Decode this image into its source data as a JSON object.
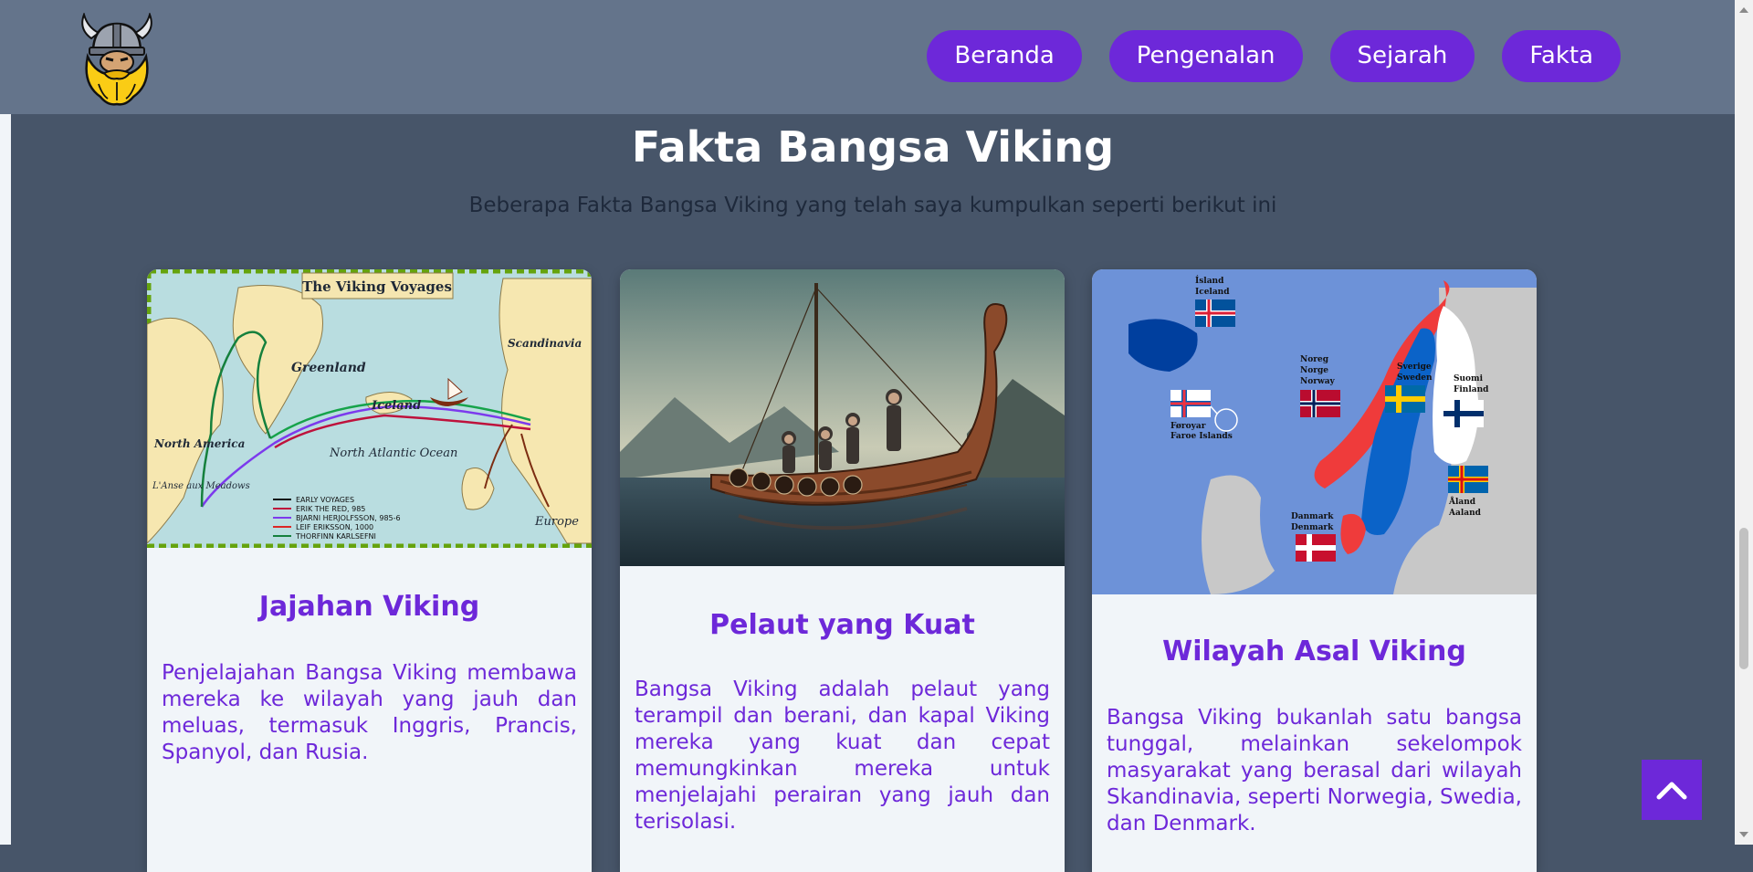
{
  "nav": {
    "items": [
      {
        "label": "Beranda"
      },
      {
        "label": "Pengenalan"
      },
      {
        "label": "Sejarah"
      },
      {
        "label": "Fakta"
      }
    ]
  },
  "section": {
    "title": "Fakta Bangsa Viking",
    "subtitle": "Beberapa Fakta Bangsa Viking yang telah saya kumpulkan seperti berikut ini"
  },
  "cards": [
    {
      "title": "Jajahan Viking",
      "text": "Penjelajahan Bangsa Viking membawa mereka ke wilayah yang jauh dan meluas, termasuk Inggris, Prancis, Spanyol, dan Rusia.",
      "image": {
        "map_title": "The Viking Voyages",
        "labels": [
          "Greenland",
          "Iceland",
          "Scandinavia",
          "North America",
          "North Atlantic Ocean",
          "L'Anse aux Meadows",
          "Europe"
        ],
        "legend": [
          "EARLY VOYAGES",
          "ERIK THE RED, 985",
          "BJARNI HERJOLFSSON, 985-6",
          "LEIF ERIKSSON, 1000",
          "THORFINN KARLSEFNI"
        ]
      }
    },
    {
      "title": "Pelaut yang Kuat",
      "text": "Bangsa Viking adalah pelaut yang terampil dan berani, dan kapal Viking mereka yang kuat dan cepat memungkinkan mereka untuk menjelajahi perairan yang jauh dan terisolasi."
    },
    {
      "title": "Wilayah Asal Viking",
      "text": "Bangsa Viking bukanlah satu bangsa tunggal, melainkan sekelompok masyarakat yang berasal dari wilayah Skandinavia, seperti Norwegia, Swedia, dan Denmark.",
      "image": {
        "labels": {
          "iceland": [
            "Ísland",
            "Iceland"
          ],
          "faroe": [
            "Føroyar",
            "Faroe Islands"
          ],
          "norway": [
            "Noreg",
            "Norge",
            "Norway"
          ],
          "sweden": [
            "Sverige",
            "Sweden"
          ],
          "finland": [
            "Suomi",
            "Finland"
          ],
          "aland": [
            "Åland",
            "Aaland"
          ],
          "denmark": [
            "Danmark",
            "Denmark"
          ]
        }
      }
    }
  ],
  "colors": {
    "accent": "#6d28d9",
    "header": "#64748b",
    "background": "#475569",
    "card": "#f1f5f9"
  }
}
